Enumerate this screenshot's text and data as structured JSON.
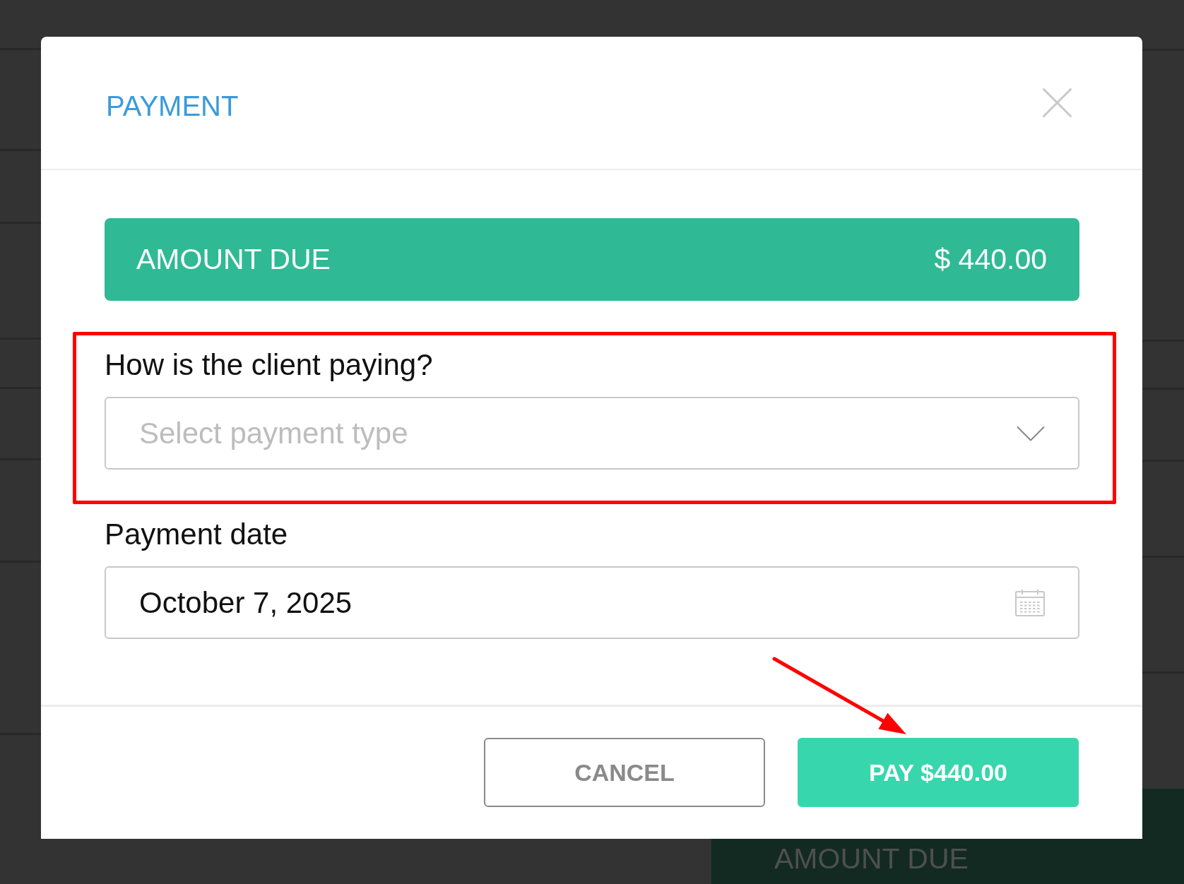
{
  "dialog": {
    "title": "PAYMENT"
  },
  "amount_due": {
    "label": "AMOUNT DUE",
    "value": "$ 440.00"
  },
  "fields": [
    {
      "kind": "select",
      "label": "How is the client paying?",
      "placeholder": "Select payment type",
      "highlighted": true
    },
    {
      "kind": "date",
      "label": "Payment date",
      "value": "October 7, 2025",
      "highlighted": false
    }
  ],
  "buttons": [
    {
      "kind": "outline",
      "label": "CANCEL",
      "pointed_at": false
    },
    {
      "kind": "filled",
      "label": "PAY $440.00",
      "pointed_at": true
    }
  ],
  "background": {
    "panel_text": "AMOUNT DUE"
  }
}
